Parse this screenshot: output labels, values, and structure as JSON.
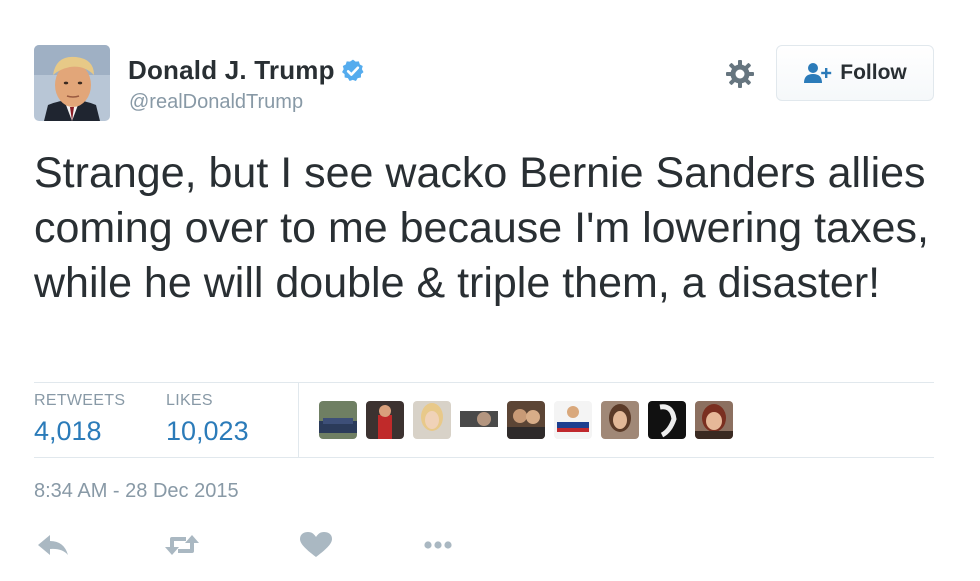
{
  "user": {
    "name": "Donald J. Trump",
    "handle": "@realDonaldTrump",
    "verified_icon": "verified-badge-icon",
    "verified_color": "#55acee"
  },
  "header_actions": {
    "settings_icon": "gear-icon",
    "follow_label": "Follow",
    "follow_icon": "add-user-icon"
  },
  "tweet": {
    "text": "Strange, but I see wacko Bernie Sanders allies coming over to me because I'm lowering taxes, while he will double & triple them, a disaster!"
  },
  "stats": {
    "retweets_label": "RETWEETS",
    "retweets_value": "4,018",
    "likes_label": "LIKES",
    "likes_value": "10,023",
    "liker_avatar_count": 9
  },
  "timestamp": "8:34 AM - 28 Dec 2015",
  "actions": {
    "reply_icon": "reply-icon",
    "retweet_icon": "retweet-icon",
    "like_icon": "heart-icon",
    "more_icon": "more-icon"
  },
  "colors": {
    "link_blue": "#2b7bb9",
    "muted": "#8899a6",
    "text": "#292f33",
    "icon_gray": "#aab8c2"
  }
}
